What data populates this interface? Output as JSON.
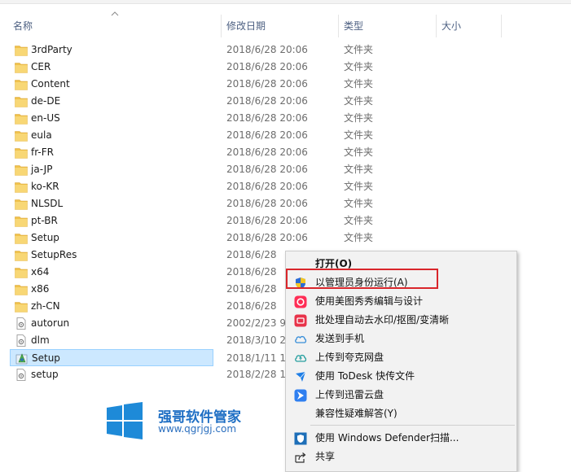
{
  "columns": {
    "name": "名称",
    "date": "修改日期",
    "type": "类型",
    "size": "大小"
  },
  "files": [
    {
      "name": "3rdParty",
      "date": "2018/6/28 20:06",
      "type": "文件夹",
      "icon": "folder-icon"
    },
    {
      "name": "CER",
      "date": "2018/6/28 20:06",
      "type": "文件夹",
      "icon": "folder-icon"
    },
    {
      "name": "Content",
      "date": "2018/6/28 20:06",
      "type": "文件夹",
      "icon": "folder-icon"
    },
    {
      "name": "de-DE",
      "date": "2018/6/28 20:06",
      "type": "文件夹",
      "icon": "folder-icon"
    },
    {
      "name": "en-US",
      "date": "2018/6/28 20:06",
      "type": "文件夹",
      "icon": "folder-icon"
    },
    {
      "name": "eula",
      "date": "2018/6/28 20:06",
      "type": "文件夹",
      "icon": "folder-icon"
    },
    {
      "name": "fr-FR",
      "date": "2018/6/28 20:06",
      "type": "文件夹",
      "icon": "folder-icon"
    },
    {
      "name": "ja-JP",
      "date": "2018/6/28 20:06",
      "type": "文件夹",
      "icon": "folder-icon"
    },
    {
      "name": "ko-KR",
      "date": "2018/6/28 20:06",
      "type": "文件夹",
      "icon": "folder-icon"
    },
    {
      "name": "NLSDL",
      "date": "2018/6/28 20:06",
      "type": "文件夹",
      "icon": "folder-icon"
    },
    {
      "name": "pt-BR",
      "date": "2018/6/28 20:06",
      "type": "文件夹",
      "icon": "folder-icon"
    },
    {
      "name": "Setup",
      "date": "2018/6/28 20:06",
      "type": "文件夹",
      "icon": "folder-icon"
    },
    {
      "name": "SetupRes",
      "date": "2018/6/28",
      "type": "",
      "icon": "folder-icon"
    },
    {
      "name": "x64",
      "date": "2018/6/28",
      "type": "",
      "icon": "folder-icon"
    },
    {
      "name": "x86",
      "date": "2018/6/28",
      "type": "",
      "icon": "folder-icon"
    },
    {
      "name": "zh-CN",
      "date": "2018/6/28",
      "type": "",
      "icon": "folder-icon"
    },
    {
      "name": "autorun",
      "date": "2002/2/23 9",
      "type": "",
      "icon": "settings-file-icon"
    },
    {
      "name": "dlm",
      "date": "2018/3/10 2",
      "type": "",
      "icon": "settings-file-icon"
    },
    {
      "name": "Setup",
      "date": "2018/1/11 1",
      "type": "",
      "icon": "setup-exe-icon",
      "selected": true
    },
    {
      "name": "setup",
      "date": "2018/2/28 1",
      "type": "",
      "icon": "settings-file-icon"
    }
  ],
  "context_menu": {
    "items": [
      {
        "label": "打开(O)",
        "icon": "",
        "bold": true
      },
      {
        "label": "以管理员身份运行(A)",
        "icon": "uac-shield-icon"
      },
      {
        "label": "使用美图秀秀编辑与设计",
        "icon": "meitu-icon"
      },
      {
        "label": "批处理自动去水印/抠图/变清晰",
        "icon": "batch-process-icon"
      },
      {
        "label": "发送到手机",
        "icon": "send-to-phone-icon"
      },
      {
        "label": "上传到夸克网盘",
        "icon": "quark-cloud-icon"
      },
      {
        "label": "使用 ToDesk 快传文件",
        "icon": "todesk-icon"
      },
      {
        "label": "上传到迅雷云盘",
        "icon": "xunlei-icon"
      },
      {
        "label": "兼容性疑难解答(Y)",
        "icon": ""
      },
      {
        "label": "使用 Windows Defender扫描...",
        "icon": "defender-icon"
      },
      {
        "label": "共享",
        "icon": "share-icon"
      }
    ]
  },
  "watermark": {
    "title": "强哥软件管家",
    "url": "www.qgrjgj.com"
  },
  "colors": {
    "selection_bg": "#cce8ff",
    "highlight_box": "#d9262b",
    "folder": "#f0c24b",
    "header_text": "#4d6082"
  }
}
